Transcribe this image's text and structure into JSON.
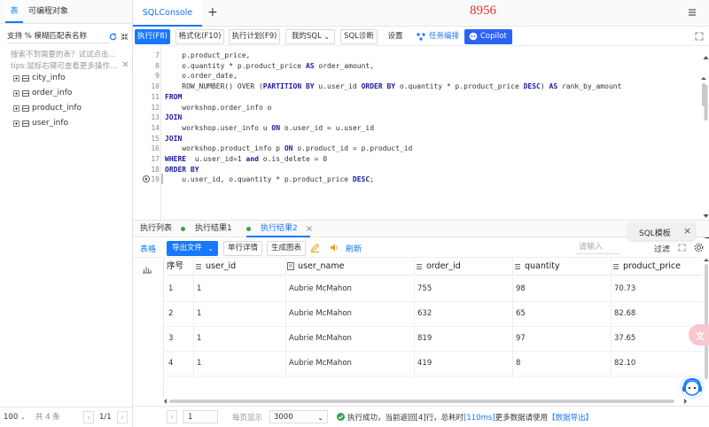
{
  "left_panel": {
    "tab_table": "表",
    "tab_objects": "可编程对象",
    "search_placeholder": "支持 % 模糊匹配表名称",
    "hint1": "搜索不到需要的表？试试点击...",
    "hint2": "tips:鼠标右键可查看更多操作...",
    "tables": [
      "city_info",
      "order_info",
      "product_info",
      "user_info"
    ],
    "footer": {
      "page_size": "100",
      "total": "共 4 条",
      "pager": "1/1"
    }
  },
  "topbar": {
    "tab_label": "SQLConsole",
    "add_tab": "+",
    "overlay_number": "8956"
  },
  "toolbar": {
    "run": "执行(F8)",
    "format": "格式化(F10)",
    "plan": "执行计划(F9)",
    "my_sql": "我的SQL",
    "diagnose": "SQL诊断",
    "settings": "设置",
    "task_orchestration": "任务编排",
    "copilot": "Copilot"
  },
  "editor": {
    "lines": [
      {
        "no": "7",
        "html": "    p.product_price,"
      },
      {
        "no": "8",
        "html": "    o.quantity * p.product_price <span class=\"kw\">AS</span> order_amount,"
      },
      {
        "no": "9",
        "html": "    o.order_date,"
      },
      {
        "no": "10",
        "html": "    ROW_NUMBER() OVER (<span class=\"kw\">PARTITION BY</span> u.user_id <span class=\"kw\">ORDER BY</span> o.quantity * p.product_price <span class=\"kw\">DESC</span>) <span class=\"kw\">AS</span> rank_by_amount"
      },
      {
        "no": "11",
        "html": "<span class=\"kw\">FROM</span>"
      },
      {
        "no": "12",
        "html": "    workshop.order_info o"
      },
      {
        "no": "13",
        "html": "<span class=\"kw\">JOIN</span>"
      },
      {
        "no": "14",
        "html": "    workshop.user_info u <span class=\"kw\">ON</span> o.user_id = u.user_id"
      },
      {
        "no": "15",
        "html": "<span class=\"kw\">JOIN</span>"
      },
      {
        "no": "16",
        "html": "    workshop.product_info p <span class=\"kw\">ON</span> o.product_id = p.product_id"
      },
      {
        "no": "17",
        "html": "<span class=\"kw\">WHERE</span>  u.user_id=1 <span class=\"kw\">and</span> o.is_delete = 0"
      },
      {
        "no": "18",
        "html": "<span class=\"kw\">ORDER BY</span>"
      },
      {
        "no": "19",
        "html": "    u.user_id, o.quantity * p.product_price <span class=\"kw\">DESC</span>;"
      }
    ]
  },
  "result_tabs": {
    "list": "执行列表",
    "result1": "执行结果1",
    "result2": "执行结果2"
  },
  "result_toolbar": {
    "table": "表格",
    "export": "导出文件",
    "row_detail": "单行详情",
    "chart": "生成图表",
    "refresh": "刷新",
    "filter_placeholder": "请输入",
    "filter": "过滤",
    "sql_template": "SQL模板"
  },
  "grid": {
    "headers": [
      "序号",
      "user_id",
      "user_name",
      "order_id",
      "quantity",
      "product_price"
    ],
    "rows": [
      [
        "1",
        "1",
        "Aubrie  McMahon",
        "755",
        "98",
        "70.73"
      ],
      [
        "2",
        "1",
        "Aubrie  McMahon",
        "632",
        "65",
        "82.68"
      ],
      [
        "3",
        "1",
        "Aubrie  McMahon",
        "819",
        "97",
        "37.65"
      ],
      [
        "4",
        "1",
        "Aubrie  McMahon",
        "419",
        "8",
        "82.10"
      ]
    ]
  },
  "result_footer": {
    "page": "1",
    "page_size_label": "每页显示",
    "page_size": "3000",
    "status_pre": "执行成功，当前返回",
    "rows": "[4]",
    "status_mid": "行，总耗时",
    "time": "[110ms]",
    "status_post": "更多数据请使用",
    "export_link": "【数据导出】"
  },
  "colors": {
    "accent": "#1677ff",
    "success": "#2ea44f",
    "keyword": "#1a1aa6",
    "overlay": "#e0322c"
  }
}
